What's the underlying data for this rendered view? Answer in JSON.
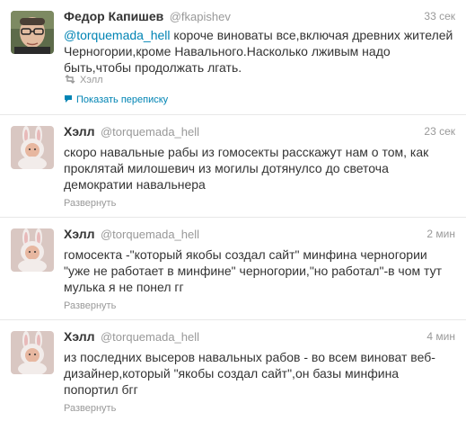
{
  "tweets": [
    {
      "fullname": "Федор Капишев",
      "username": "@fkapishev",
      "time": "33 сек",
      "mention": "@torquemada_hell",
      "text": " короче виноваты все,включая древних жителей Черногории,кроме Навального.Насколько лживым надо быть,чтобы продолжать лгать.",
      "retweeted_by": "Хэлл",
      "action": "Показать переписку",
      "avatar_icon": "man-with-glasses-photo"
    },
    {
      "fullname": "Хэлл",
      "username": "@torquemada_hell",
      "time": "23 сек",
      "text": "скоро навальные рабы из гомосекты расскажут нам о том, как проклятай милошевич из могилы дотянулсо до светоча демократии навальнера",
      "action": "Развернуть",
      "avatar_icon": "bunny-costume-baby-photo"
    },
    {
      "fullname": "Хэлл",
      "username": "@torquemada_hell",
      "time": "2 мин",
      "text": "гомосекта -\"который якобы создал сайт\" минфина черногории \"уже не работает в минфине\" черногории,\"но работал\"-в чом тут мулька я не понел гг",
      "action": "Развернуть",
      "avatar_icon": "bunny-costume-baby-photo"
    },
    {
      "fullname": "Хэлл",
      "username": "@torquemada_hell",
      "time": "4 мин",
      "text": "из последних высеров навальных рабов - во всем виноват веб-дизайнер,который \"якобы создал сайт\",он базы минфина попортил бгг",
      "action": "Развернуть",
      "avatar_icon": "bunny-costume-baby-photo"
    }
  ],
  "colors": {
    "link": "#0084b4",
    "muted": "#999999",
    "text": "#333333"
  }
}
